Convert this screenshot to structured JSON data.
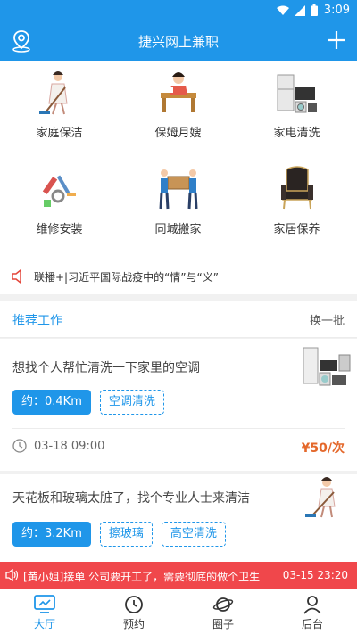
{
  "status": {
    "time": "3:09"
  },
  "header": {
    "title": "捷兴网上兼职"
  },
  "services": [
    {
      "label": "家庭保洁",
      "icon": "cleaning-lady-icon"
    },
    {
      "label": "保姆月嫂",
      "icon": "nanny-icon"
    },
    {
      "label": "家电清洗",
      "icon": "appliances-icon"
    },
    {
      "label": "维修安装",
      "icon": "repair-tools-icon"
    },
    {
      "label": "同城搬家",
      "icon": "movers-icon"
    },
    {
      "label": "家居保养",
      "icon": "armchair-icon"
    }
  ],
  "ticker": {
    "text": "联播+|习近平国际战疫中的“情”与“义”"
  },
  "recommend": {
    "title": "推荐工作",
    "refresh": "换一批"
  },
  "jobs": [
    {
      "title": "想找个人帮忙清洗一下家里的空调",
      "distance": "约：0.4Km",
      "tags": [
        "空调清洗"
      ],
      "time": "03-18 09:00",
      "price": "¥50/次",
      "image": "appliances-photo"
    },
    {
      "title": "天花板和玻璃太脏了，找个专业人士来清洁",
      "distance": "约：3.2Km",
      "tags": [
        "擦玻璃",
        "高空清洗"
      ],
      "image": "cleaning-lady-photo"
    }
  ],
  "banner": {
    "message": "[黄小姐]接单 公司要开工了，需要彻底的做个卫生",
    "datetime": "03-15 23:20"
  },
  "tabs": [
    {
      "label": "大厅",
      "icon": "monitor-icon",
      "active": true
    },
    {
      "label": "预约",
      "icon": "clock-history-icon",
      "active": false
    },
    {
      "label": "圈子",
      "icon": "planet-icon",
      "active": false
    },
    {
      "label": "后台",
      "icon": "person-icon",
      "active": false
    }
  ],
  "colors": {
    "primary": "#1f96e9",
    "accent": "#e4682b",
    "banner": "#f0474b"
  }
}
